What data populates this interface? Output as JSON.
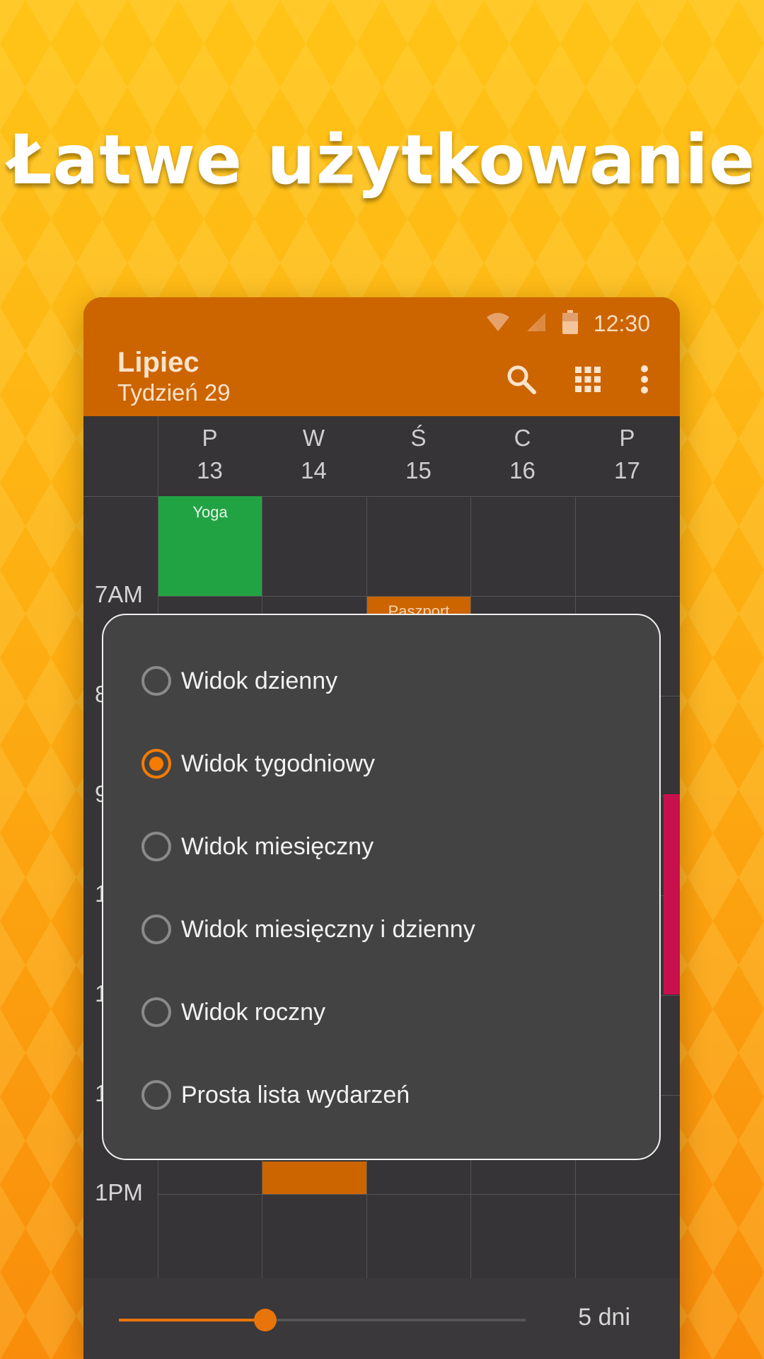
{
  "headline": "Łatwe użytkowanie",
  "status": {
    "time": "12:30"
  },
  "appbar": {
    "title": "Lipiec",
    "subtitle": "Tydzień 29"
  },
  "icons": {
    "wifi": "wifi-icon",
    "signal": "signal-icon",
    "battery": "battery-icon",
    "search": "search-icon",
    "grid": "grid-icon",
    "more": "more-vert-icon"
  },
  "days": [
    {
      "letter": "P",
      "num": "13"
    },
    {
      "letter": "W",
      "num": "14"
    },
    {
      "letter": "Ś",
      "num": "15"
    },
    {
      "letter": "C",
      "num": "16"
    },
    {
      "letter": "P",
      "num": "17"
    }
  ],
  "hours": [
    "7AM",
    "8",
    "9",
    "1",
    "1",
    "1",
    "1PM"
  ],
  "events": {
    "yoga": {
      "label": "Yoga",
      "color": "#21a343"
    },
    "passport": {
      "label": "Paszport",
      "color": "#cc6400"
    },
    "pink": {
      "color": "#c8104f"
    },
    "orange_block": {
      "color": "#cc6400"
    }
  },
  "dialog": {
    "options": [
      {
        "label": "Widok dzienny",
        "checked": false
      },
      {
        "label": "Widok tygodniowy",
        "checked": true
      },
      {
        "label": "Widok miesięczny",
        "checked": false
      },
      {
        "label": "Widok miesięczny i dzienny",
        "checked": false
      },
      {
        "label": "Widok roczny",
        "checked": false
      },
      {
        "label": "Prosta lista wydarzeń",
        "checked": false
      }
    ]
  },
  "slider": {
    "value": 0.36,
    "label": "5 dni"
  },
  "colors": {
    "accent": "#f57c00",
    "appbar": "#cc6400",
    "surface": "#363436"
  }
}
